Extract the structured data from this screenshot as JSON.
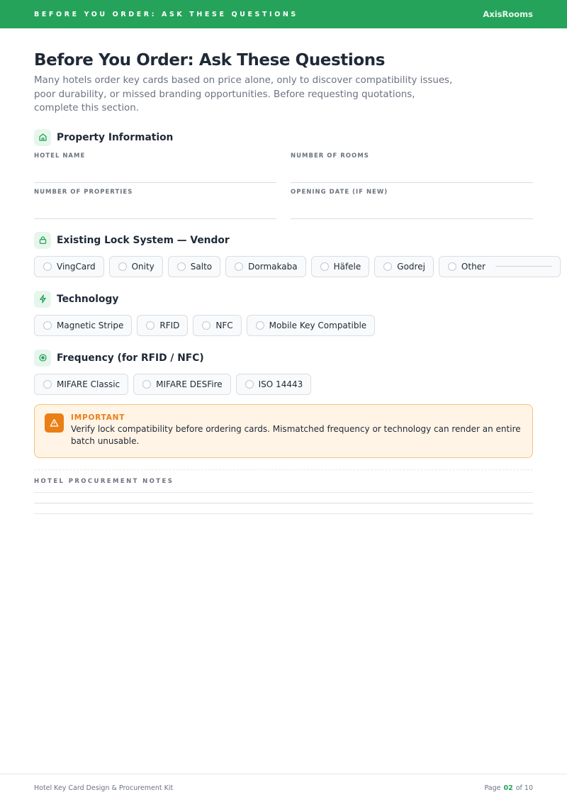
{
  "header": {
    "kicker": "BEFORE YOU ORDER: ASK THESE QUESTIONS",
    "brand": "AxisRooms"
  },
  "page": {
    "title": "Before You Order: Ask These Questions",
    "intro": "Many hotels order key cards based on price alone, only to discover compatibility issues, poor durability, or missed branding opportunities. Before requesting quotations, complete this section."
  },
  "property": {
    "title": "Property Information",
    "icon": "home-icon",
    "fields": {
      "hotel_name": "HOTEL NAME",
      "rooms": "NUMBER OF ROOMS",
      "properties": "NUMBER OF PROPERTIES",
      "opening": "OPENING DATE (IF NEW)"
    }
  },
  "lock": {
    "title": "Existing Lock System — Vendor",
    "icon": "lock-icon",
    "options": [
      "VingCard",
      "Onity",
      "Salto",
      "Dormakaba",
      "Häfele",
      "Godrej",
      "Other"
    ]
  },
  "technology": {
    "title": "Technology",
    "icon": "lightning-icon",
    "options": [
      "Magnetic Stripe",
      "RFID",
      "NFC",
      "Mobile Key Compatible"
    ]
  },
  "frequency": {
    "title": "Frequency (for RFID / NFC)",
    "icon": "target-icon",
    "options": [
      "MIFARE Classic",
      "MIFARE DESFire",
      "ISO 14443"
    ]
  },
  "callout": {
    "icon": "warning-icon",
    "title": "IMPORTANT",
    "text": "Verify lock compatibility before ordering cards. Mismatched frequency or technology can render an entire batch unusable."
  },
  "notes": {
    "label": "HOTEL PROCUREMENT NOTES"
  },
  "footer": {
    "doc_title": "Hotel Key Card Design & Procurement Kit",
    "page_label": "Page",
    "page_num": "02",
    "of_label": "of 10"
  },
  "colors": {
    "brand_green": "#26a35a",
    "warning_orange": "#ea7f16",
    "warning_bg": "#fff4e6"
  }
}
